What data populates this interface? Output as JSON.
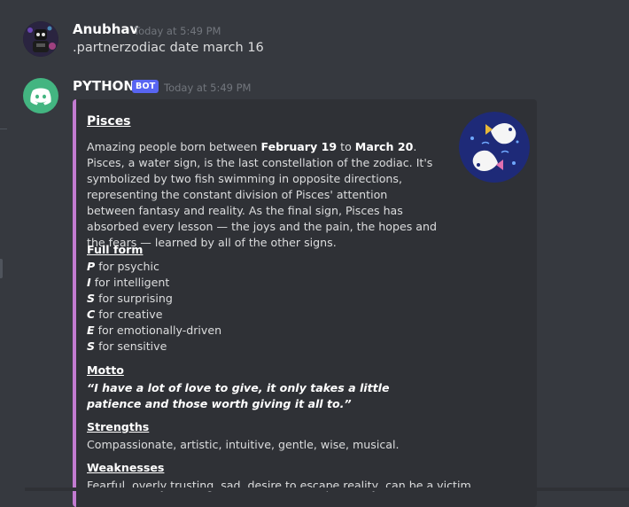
{
  "messages": [
    {
      "username": "Anubhav",
      "timestamp": "Today at 5:49 PM",
      "content": ".partnerzodiac date march 16"
    },
    {
      "username": "PYTHON",
      "bot_tag": "BOT",
      "timestamp": "Today at 5:49 PM"
    }
  ],
  "embed": {
    "accent_color": "#c27bd0",
    "title": "Pisces",
    "description": {
      "p1": "Amazing people born between ",
      "b1": "February 19",
      "p2": " to ",
      "b2": "March 20",
      "p3": ". Pisces, a water sign, is the last constellation of the zodiac. It's symbolized by two fish swimming in opposite directions, representing the constant division of Pisces' attention between fantasy and reality. As the final sign, Pisces has absorbed every lesson — the joys and the pain, the hopes and the fears — learned by all of the other signs."
    },
    "full_form": {
      "name": "Full form",
      "lines": [
        {
          "letter": "P",
          "text": "for psychic"
        },
        {
          "letter": "I",
          "text": "for intelligent"
        },
        {
          "letter": "S",
          "text": "for surprising"
        },
        {
          "letter": "C",
          "text": "for creative"
        },
        {
          "letter": "E",
          "text": "for emotionally-driven"
        },
        {
          "letter": "S",
          "text": "for sensitive"
        }
      ]
    },
    "motto": {
      "name": "Motto",
      "value": "“I have a lot of love to give, it only takes a little patience and those worth giving it all to.”"
    },
    "strengths": {
      "name": "Strengths",
      "value": "Compassionate, artistic, intuitive, gentle, wise, musical."
    },
    "weaknesses": {
      "name": "Weaknesses",
      "value": "Fearful, overly trusting, sad, desire to escape reality, can be a victim"
    }
  },
  "icons": {
    "user_avatar": "robot-avatar-icon",
    "bot_avatar": "discord-logo-icon",
    "thumbnail": "pisces-fish-icon"
  },
  "colors": {
    "background": "#36393f",
    "embed_bg": "#2f3136",
    "bot_avatar_bg": "#43b581",
    "bot_tag": "#5865f2"
  }
}
